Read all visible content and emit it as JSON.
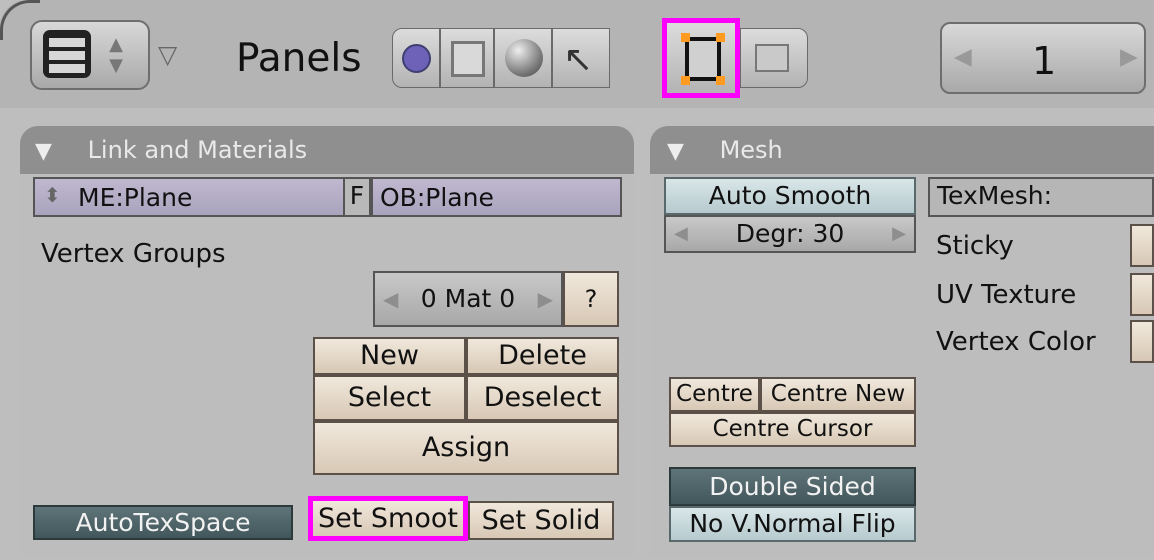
{
  "header": {
    "panels_label": "Panels",
    "frame_value": "1",
    "frame_left_arrow": "◀",
    "frame_right_arrow": "▶"
  },
  "link_materials": {
    "title": "Link and Materials",
    "me_field": "ME:Plane",
    "f_label": "F",
    "ob_field": "OB:Plane",
    "vertex_groups": "Vertex Groups",
    "mat_field": "0 Mat 0",
    "mat_help": "?",
    "buttons": {
      "new": "New",
      "delete": "Delete",
      "select": "Select",
      "deselect": "Deselect",
      "assign": "Assign",
      "autotex": "AutoTexSpace",
      "set_smooth": "Set Smoot",
      "set_solid": "Set Solid"
    }
  },
  "mesh": {
    "title": "Mesh",
    "auto_smooth": "Auto Smooth",
    "degr": "Degr: 30",
    "texmesh": "TexMesh:",
    "sticky": "Sticky",
    "uv_texture": "UV Texture",
    "vertex_color": "Vertex Color",
    "centre": "Centre",
    "centre_new": "Centre New",
    "centre_cursor": "Centre Cursor",
    "double_sided": "Double Sided",
    "no_vnormal_flip": "No V.Normal Flip"
  },
  "colors": {
    "highlight": "#ff00ff",
    "panel_header": "#8f8f8f",
    "beige_button": "#e8dccf",
    "dark_button": "#4f6468"
  }
}
